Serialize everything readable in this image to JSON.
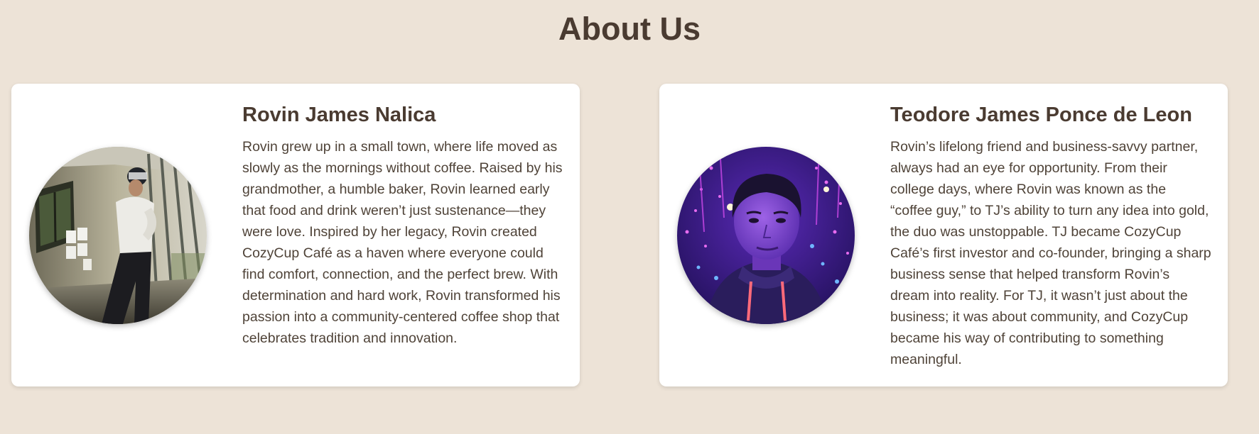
{
  "page": {
    "title": "About Us"
  },
  "members": [
    {
      "name": "Rovin James Nalica",
      "bio": "Rovin grew up in a small town, where life moved as slowly as the mornings without coffee. Raised by his grandmother, a humble baker, Rovin learned early that food and drink weren’t just sustenance—they were love. Inspired by her legacy, Rovin created CozyCup Café as a haven where everyone could find comfort, connection, and the perfect brew. With determination and hard work, Rovin transformed his passion into a community-centered coffee shop that celebrates tradition and innovation."
    },
    {
      "name": "Teodore James Ponce de Leon",
      "bio": "Rovin’s lifelong friend and business-savvy partner, always had an eye for opportunity. From their college days, where Rovin was known as the “coffee guy,” to TJ’s ability to turn any idea into gold, the duo was unstoppable. TJ became CozyCup Café’s first investor and co-founder, bringing a sharp business sense that helped transform Rovin’s dream into reality. For TJ, it wasn’t just about the business; it was about community, and CozyCup became his way of contributing to something meaningful."
    }
  ],
  "colors": {
    "background": "#ede3d7",
    "card": "#ffffff",
    "heading": "#4a3b31",
    "body_text": "#4f4338"
  }
}
